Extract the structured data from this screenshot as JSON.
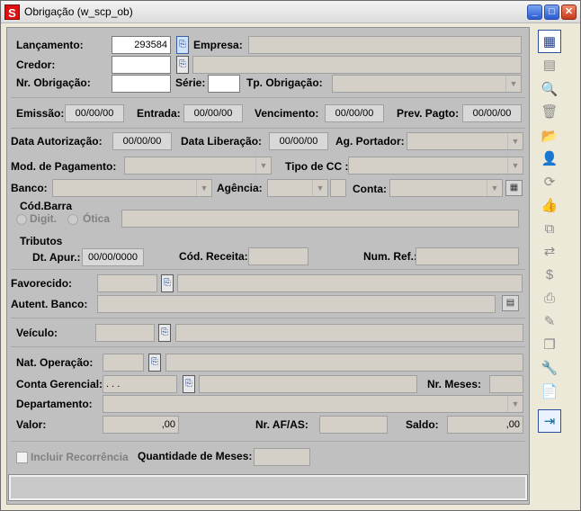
{
  "window": {
    "title": "Obrigação (w_scp_ob)",
    "app_icon_letter": "S"
  },
  "controls": {
    "minimize": "_",
    "maximize": "□",
    "close": "✕"
  },
  "form": {
    "lancamento": {
      "label": "Lançamento:",
      "value": "293584"
    },
    "empresa": {
      "label": "Empresa:",
      "value": ""
    },
    "credor": {
      "label": "Credor:",
      "value": ""
    },
    "nr_obrigacao": {
      "label": "Nr. Obrigação:",
      "value": ""
    },
    "serie": {
      "label": "Série:",
      "value": ""
    },
    "tp_obrigacao": {
      "label": "Tp. Obrigação:",
      "value": ""
    },
    "emissao": {
      "label": "Emissão:",
      "value": "00/00/00"
    },
    "entrada": {
      "label": "Entrada:",
      "value": "00/00/00"
    },
    "vencimento": {
      "label": "Vencimento:",
      "value": "00/00/00"
    },
    "prev_pagto": {
      "label": "Prev. Pagto:",
      "value": "00/00/00"
    },
    "data_autorizacao": {
      "label": "Data Autorização:",
      "value": "00/00/00"
    },
    "data_liberacao": {
      "label": "Data Liberação:",
      "value": "00/00/00"
    },
    "ag_portador": {
      "label": "Ag. Portador:",
      "value": ""
    },
    "mod_pagamento": {
      "label": "Mod. de Pagamento:",
      "value": ""
    },
    "tipo_cc": {
      "label": "Tipo de CC :",
      "value": ""
    },
    "banco": {
      "label": "Banco:",
      "value": ""
    },
    "agencia": {
      "label": "Agência:",
      "value": ""
    },
    "conta": {
      "label": "Conta:",
      "value": ""
    },
    "cod_barra": {
      "label": "Cód.Barra",
      "opt_digit": "Digit.",
      "opt_otica": "Ótica",
      "value": ""
    },
    "tributos": {
      "label": "Tributos"
    },
    "dt_apur": {
      "label": "Dt. Apur.:",
      "value": "00/00/0000"
    },
    "cod_receita": {
      "label": "Cód. Receita:",
      "value": ""
    },
    "num_ref": {
      "label": "Num. Ref.:",
      "value": ""
    },
    "favorecido": {
      "label": "Favorecido:",
      "value": ""
    },
    "autent_banco": {
      "label": "Autent. Banco:",
      "value": ""
    },
    "veiculo": {
      "label": "Veículo:",
      "value": ""
    },
    "nat_operacao": {
      "label": "Nat. Operação:",
      "value": ""
    },
    "conta_gerencial": {
      "label": "Conta Gerencial:",
      "value": ". . ."
    },
    "nr_meses": {
      "label": "Nr. Meses:",
      "value": ""
    },
    "departamento": {
      "label": "Departamento:",
      "value": ""
    },
    "valor": {
      "label": "Valor:",
      "value": ",00"
    },
    "nr_afas": {
      "label": "Nr. AF/AS:",
      "value": ""
    },
    "saldo": {
      "label": "Saldo:",
      "value": ",00"
    },
    "incluir_recorrencia": {
      "label": "Incluir Recorrência",
      "checked": false
    },
    "quantidade_meses": {
      "label": "Quantidade de Meses:",
      "value": ""
    }
  },
  "toolbar": {
    "buttons": [
      {
        "name": "new-record",
        "glyph": "▦",
        "enabled": true
      },
      {
        "name": "insert-row",
        "glyph": "▤",
        "enabled": false
      },
      {
        "name": "print-preview",
        "glyph": "🔍",
        "enabled": false
      },
      {
        "name": "delete",
        "glyph": "🗑",
        "enabled": false
      },
      {
        "name": "open",
        "glyph": "📂",
        "enabled": false
      },
      {
        "name": "user",
        "glyph": "👤",
        "enabled": false
      },
      {
        "name": "refresh",
        "glyph": "⟳",
        "enabled": false
      },
      {
        "name": "approve",
        "glyph": "👍",
        "enabled": false
      },
      {
        "name": "copy",
        "glyph": "⧉",
        "enabled": false
      },
      {
        "name": "transfer",
        "glyph": "⇄",
        "enabled": false
      },
      {
        "name": "money",
        "glyph": "$",
        "enabled": false
      },
      {
        "name": "print",
        "glyph": "⎙",
        "enabled": false
      },
      {
        "name": "notes",
        "glyph": "✎",
        "enabled": false
      },
      {
        "name": "duplicate",
        "glyph": "❐",
        "enabled": false
      },
      {
        "name": "tools",
        "glyph": "🔧",
        "enabled": false
      },
      {
        "name": "document",
        "glyph": "📄",
        "enabled": false
      },
      {
        "name": "exit",
        "glyph": "⇥",
        "enabled": true
      }
    ]
  }
}
